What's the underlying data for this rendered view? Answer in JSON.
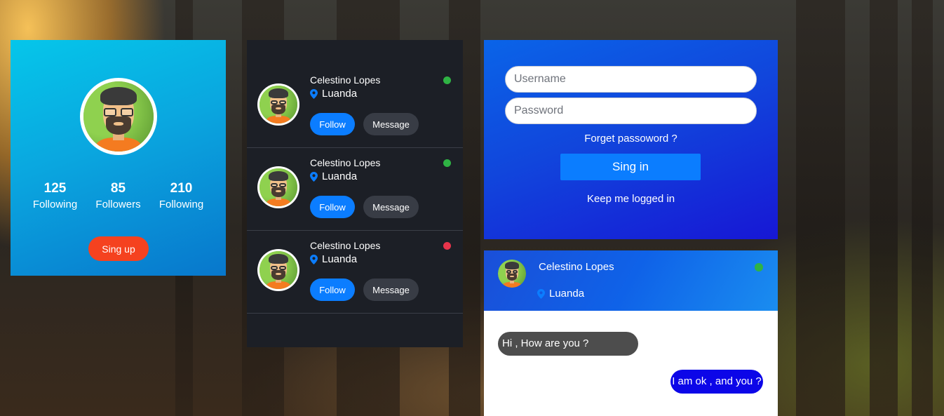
{
  "profile": {
    "stats": [
      {
        "value": "125",
        "label": "Following"
      },
      {
        "value": "85",
        "label": "Followers"
      },
      {
        "value": "210",
        "label": "Following"
      }
    ],
    "signup_label": "Sing up"
  },
  "contacts": [
    {
      "name": "Celestino Lopes",
      "location": "Luanda",
      "status": "online",
      "status_color": "#2fb344",
      "follow_label": "Follow",
      "message_label": "Message"
    },
    {
      "name": "Celestino Lopes",
      "location": "Luanda",
      "status": "online",
      "status_color": "#2fb344",
      "follow_label": "Follow",
      "message_label": "Message"
    },
    {
      "name": "Celestino Lopes",
      "location": "Luanda",
      "status": "busy",
      "status_color": "#e8344b",
      "follow_label": "Follow",
      "message_label": "Message"
    }
  ],
  "login": {
    "username_placeholder": "Username",
    "password_placeholder": "Password",
    "forgot_label": "Forget passoword ?",
    "signin_label": "Sing in",
    "keep_label": "Keep me logged in"
  },
  "chat": {
    "name": "Celestino Lopes",
    "location": "Luanda",
    "status_color": "#2fb344",
    "messages": [
      {
        "direction": "in",
        "text": "Hi , How are you ?"
      },
      {
        "direction": "out",
        "text": "I am ok , and you ?"
      }
    ]
  },
  "colors": {
    "accent": "#0b7dff",
    "signup": "#f5421f",
    "pin": "#0b7dff"
  }
}
